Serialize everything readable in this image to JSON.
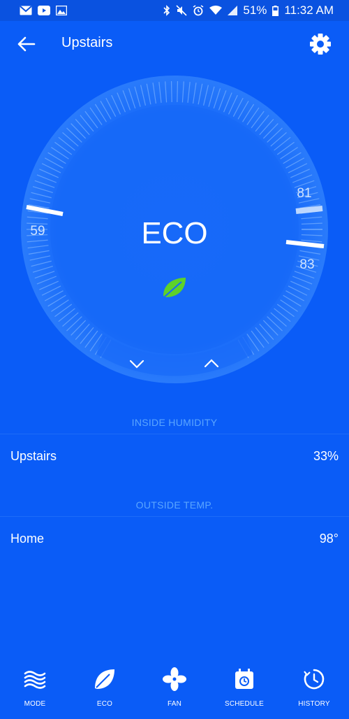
{
  "status_bar": {
    "battery": "51%",
    "time": "11:32 AM",
    "left_icons": [
      "gmail-icon",
      "youtube-icon",
      "gallery-icon"
    ],
    "right_icons": [
      "bluetooth-icon",
      "mute-icon",
      "alarm-icon",
      "wifi-icon",
      "signal-icon",
      "battery-icon"
    ]
  },
  "header": {
    "title": "Upstairs",
    "back_icon": "arrow-left-icon",
    "settings_icon": "gear-icon"
  },
  "thermostat": {
    "mode_label": "ECO",
    "mode_icon": "leaf-icon",
    "eco_low": "59",
    "eco_high": "81",
    "current": "83",
    "down_icon": "chevron-down-icon",
    "up_icon": "chevron-up-icon"
  },
  "inside_humidity": {
    "header": "INSIDE HUMIDITY",
    "location": "Upstairs",
    "value": "33%"
  },
  "outside_temp": {
    "header": "OUTSIDE TEMP.",
    "location": "Home",
    "value": "98°"
  },
  "nav": {
    "items": [
      {
        "label": "MODE",
        "icon": "waves-icon"
      },
      {
        "label": "ECO",
        "icon": "leaf-icon"
      },
      {
        "label": "FAN",
        "icon": "fan-icon"
      },
      {
        "label": "SCHEDULE",
        "icon": "calendar-icon"
      },
      {
        "label": "HISTORY",
        "icon": "history-icon"
      }
    ]
  },
  "colors": {
    "background": "#0a5cf7",
    "status_bar": "#0a52e0",
    "accent_text": "#5ba6ff",
    "leaf": "#5ed12a"
  }
}
